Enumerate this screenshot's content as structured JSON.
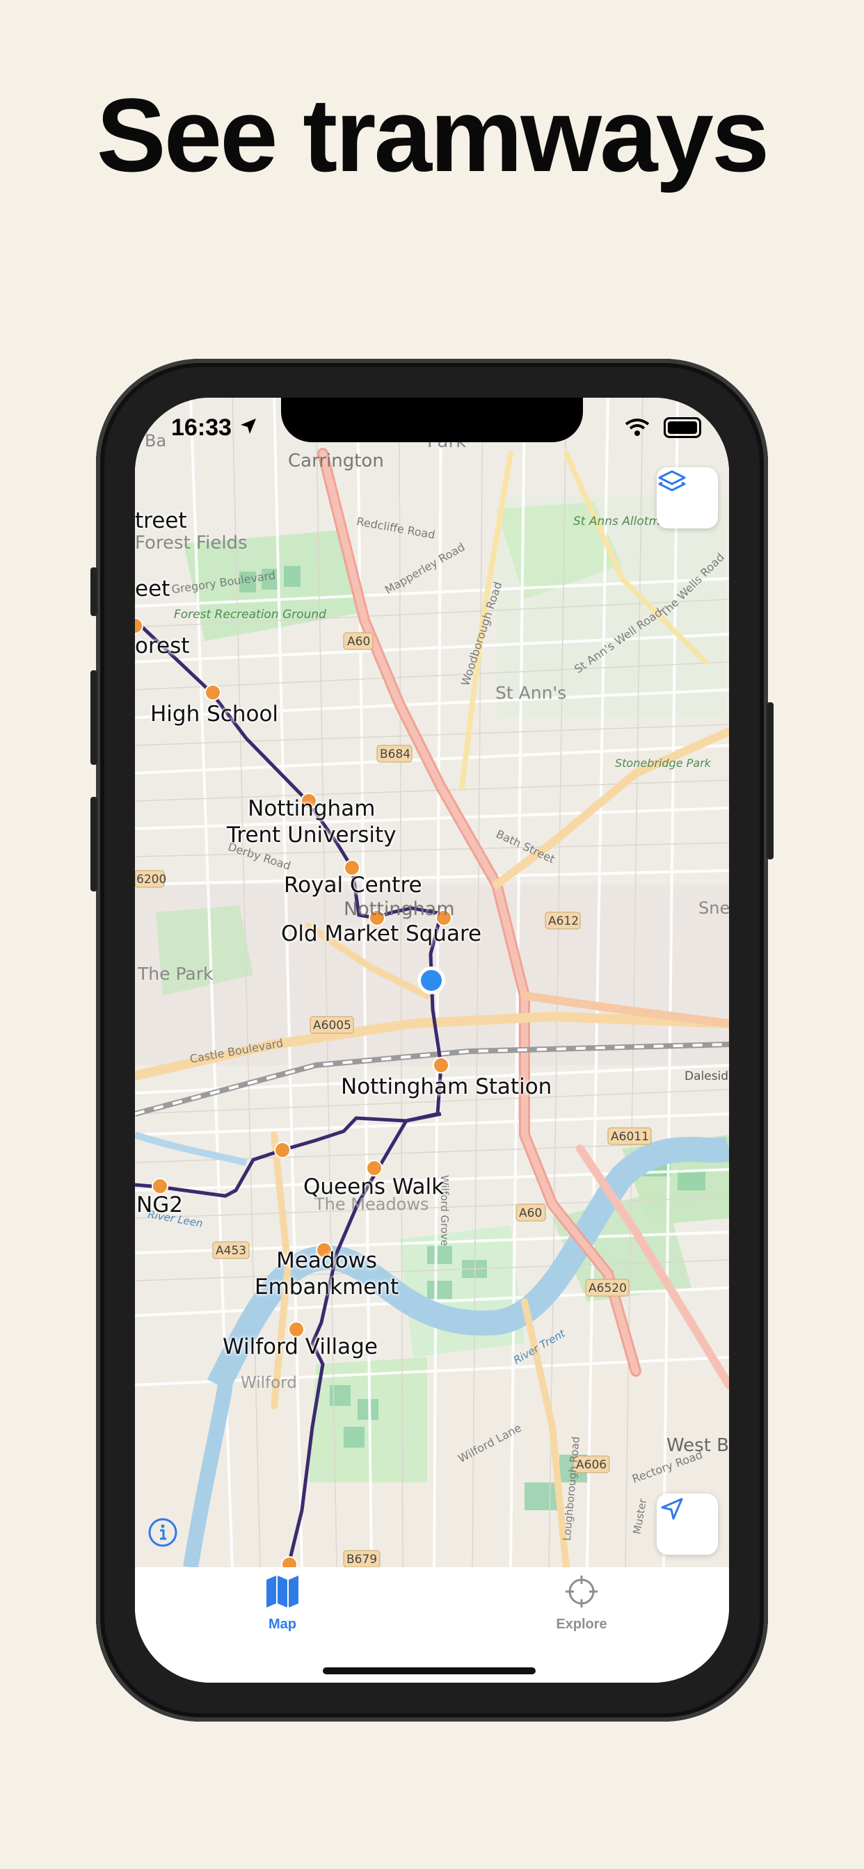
{
  "headline": "See tramways",
  "status": {
    "time": "16:33"
  },
  "map": {
    "stations": [
      {
        "name": "High School"
      },
      {
        "name": "Nottingham\nTrent University"
      },
      {
        "name": "Royal Centre"
      },
      {
        "name": "Old Market Square"
      },
      {
        "name": "Nottingham Station"
      },
      {
        "name": "Queens Walk"
      },
      {
        "name": "Meadows\nEmbankment"
      },
      {
        "name": "Wilford Village"
      },
      {
        "name": "NG2"
      }
    ],
    "partial_labels": [
      "treet",
      "eet",
      "orest"
    ],
    "places": [
      "Carrington",
      "Forest Fields",
      "Gregory Boulevard",
      "Forest Recreation Ground",
      "St Anns Allotments",
      "St Ann's",
      "Stonebridge Park",
      "Bath Street",
      "Derby Road",
      "The Park",
      "Castle Boulevard",
      "The Meadows",
      "Wilford",
      "Wilford Lane",
      "Rectory Road",
      "Redcliffe Road",
      "Mapperley Road",
      "Woodborough Road",
      "St Ann's Well Road",
      "The Wells Road",
      "Nottingham",
      "Dalesid",
      "West B",
      "Sne",
      "Wilford Grove",
      "Loughborough Road",
      "Park",
      "Ba",
      "River Trent",
      "River Leen",
      "Muster"
    ],
    "road_shields": [
      "A60",
      "B684",
      "A612",
      "A6005",
      "A6011",
      "A60",
      "A453",
      "A6520",
      "A606",
      "B679",
      "6200"
    ]
  },
  "tabs": [
    {
      "label": "Map",
      "icon": "map-icon",
      "active": true
    },
    {
      "label": "Explore",
      "icon": "crosshair-icon",
      "active": false
    }
  ],
  "colors": {
    "accent": "#2f7be8",
    "tram_line": "#3b2a6e",
    "station": "#f09438",
    "user_dot": "#2d8cf0"
  }
}
